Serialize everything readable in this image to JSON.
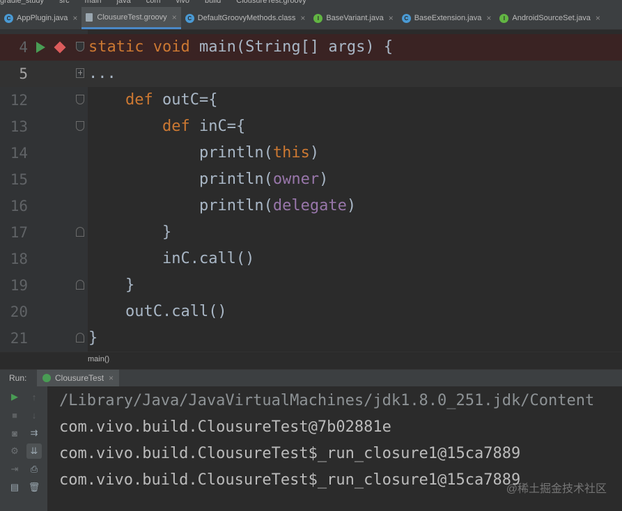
{
  "breadcrumbs": [
    "gradle_study",
    "src",
    "main",
    "java",
    "com",
    "vivo",
    "build",
    "ClousureTest.groovy"
  ],
  "tabs": [
    {
      "label": "AppPlugin.java",
      "icon": "class-icon",
      "color": "#4a9ad4",
      "active": false
    },
    {
      "label": "ClousureTest.groovy",
      "icon": "groovy-file-icon",
      "color": "#9aa7b0",
      "active": true
    },
    {
      "label": "DefaultGroovyMethods.class",
      "icon": "class-icon",
      "color": "#4a9ad4",
      "active": false
    },
    {
      "label": "BaseVariant.java",
      "icon": "interface-icon",
      "color": "#62b543",
      "active": false
    },
    {
      "label": "BaseExtension.java",
      "icon": "class-icon",
      "color": "#4a9ad4",
      "active": false
    },
    {
      "label": "AndroidSourceSet.java",
      "icon": "interface-icon",
      "color": "#62b543",
      "active": false
    }
  ],
  "tab_close_glyph": "×",
  "editor": {
    "lines": [
      {
        "num": "4",
        "current": false
      },
      {
        "num": "5",
        "current": true
      },
      {
        "num": "12",
        "current": false
      },
      {
        "num": "13",
        "current": false
      },
      {
        "num": "14",
        "current": false
      },
      {
        "num": "15",
        "current": false
      },
      {
        "num": "16",
        "current": false
      },
      {
        "num": "17",
        "current": false
      },
      {
        "num": "18",
        "current": false
      },
      {
        "num": "19",
        "current": false
      },
      {
        "num": "20",
        "current": false
      },
      {
        "num": "21",
        "current": false
      }
    ],
    "code": {
      "l4_kw": "static void",
      "l4_rest": " main(String[] args) {",
      "l5": "...",
      "l12_kw": "def",
      "l12_rest": " outC={",
      "l13_kw": "def",
      "l13_rest": " inC={",
      "l14_a": "println(",
      "l14_b": "this",
      "l14_c": ")",
      "l15_a": "println(",
      "l15_b": "owner",
      "l15_c": ")",
      "l16_a": "println(",
      "l16_b": "delegate",
      "l16_c": ")",
      "l17": "}",
      "l18": "inC.call()",
      "l19": "}",
      "l20": "outC.call()",
      "l21": "}"
    }
  },
  "editor_breadcrumb": "main()",
  "run_panel": {
    "label": "Run:",
    "tab_label": "ClousureTest",
    "tab_close": "×",
    "output": [
      "/Library/Java/JavaVirtualMachines/jdk1.8.0_251.jdk/Content",
      "com.vivo.build.ClousureTest@7b02881e",
      "com.vivo.build.ClousureTest$_run_closure1@15ca7889",
      "com.vivo.build.ClousureTest$_run_closure1@15ca7889"
    ]
  },
  "watermark": "@稀土掘金技术社区",
  "colors": {
    "keyword": "#cc7832",
    "field": "#9876aa",
    "text": "#a9b7c6",
    "run": "#499c54",
    "breakpoint": "#db5c5c"
  }
}
